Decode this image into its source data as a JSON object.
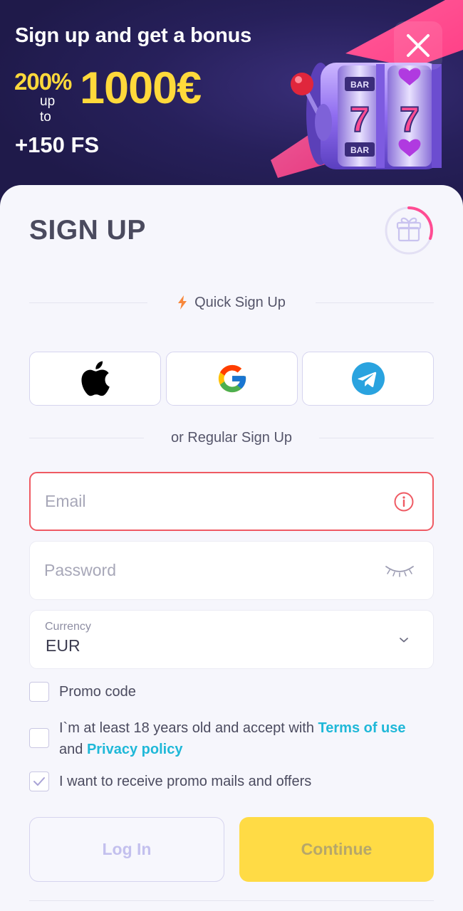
{
  "banner": {
    "title": "Sign up and get a bonus",
    "bonus_percent": "200%",
    "bonus_upto": "up to",
    "bonus_amount": "1000€",
    "free_spins": "+150 FS",
    "slot_symbols": [
      "BAR",
      "7",
      "BAR"
    ],
    "accent_color": "#ffd93b",
    "background_color": "#241d52"
  },
  "card": {
    "title": "SIGN UP",
    "quick_signup_label": "Quick Sign Up",
    "social_providers": [
      "apple",
      "google",
      "telegram"
    ],
    "regular_signup_label": "or Regular Sign Up"
  },
  "form": {
    "email": {
      "placeholder": "Email",
      "value": "",
      "state": "error"
    },
    "password": {
      "placeholder": "Password",
      "value": ""
    },
    "currency": {
      "label": "Currency",
      "value": "EUR"
    },
    "promo_code": {
      "label": "Promo code",
      "checked": false
    },
    "age_terms": {
      "text_before": "I`m at least 18 years old and accept with ",
      "terms_link": "Terms of use",
      "text_and": " and ",
      "privacy_link": "Privacy policy",
      "checked": false
    },
    "promo_mails": {
      "label": "I want to receive promo mails and offers",
      "checked": true
    }
  },
  "actions": {
    "login_label": "Log In",
    "continue_label": "Continue"
  },
  "colors": {
    "error": "#ef5a63",
    "link": "#1fb8d8",
    "primary_button": "#ffdb45"
  }
}
